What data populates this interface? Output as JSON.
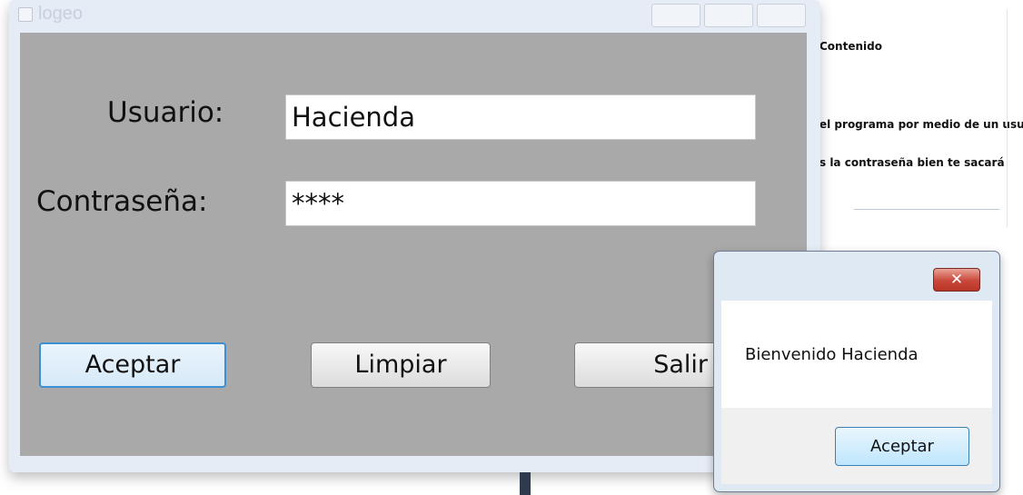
{
  "login_window": {
    "title": "logeo",
    "username_label": "Usuario:",
    "username_value": "Hacienda",
    "password_label": "Contraseña:",
    "password_value": "****",
    "accept_label": "Aceptar",
    "clear_label": "Limpiar",
    "exit_label": "Salir"
  },
  "background_document": {
    "line1": "Contenido",
    "line2": "el programa por medio de un usu",
    "line3": "s la contraseña bien te sacará"
  },
  "message_box": {
    "close_glyph": "✕",
    "message": "Bienvenido Hacienda",
    "ok_label": "Aceptar"
  }
}
